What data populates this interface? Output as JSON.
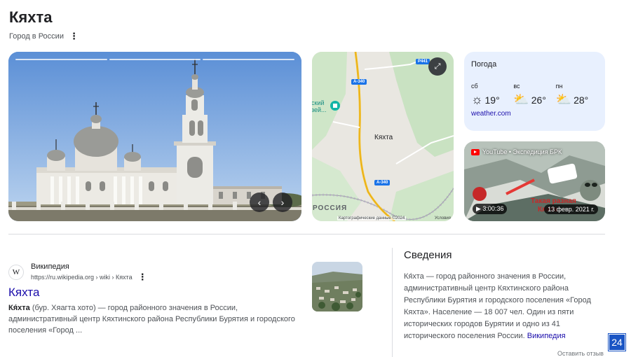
{
  "header": {
    "title": "Кяхта",
    "subtitle": "Город в России"
  },
  "photo": {
    "slide_count": 3,
    "prev_label": "‹",
    "next_label": "›"
  },
  "map": {
    "city": "Кяхта",
    "country": "РОССИЯ",
    "museum": "ский\nзей...",
    "roads": [
      "P441",
      "А-340",
      "А-340"
    ],
    "credit": "Картографические данные ©2024",
    "terms": "Условия"
  },
  "weather": {
    "title": "Погода",
    "days": [
      {
        "day": "сб",
        "temp": "19°",
        "icon": "sun-icon"
      },
      {
        "day": "вс",
        "temp": "26°",
        "icon": "partly-cloudy-icon"
      },
      {
        "day": "пн",
        "temp": "28°",
        "icon": "partly-cloudy-icon"
      }
    ],
    "source": "weather.com"
  },
  "video": {
    "channel": "YouTube • Экспедиция БРК",
    "duration": "3:00:36",
    "date": "13 февр. 2021 г.",
    "overlay_text": "Такая разная Кяхта"
  },
  "result": {
    "source_name": "Википедия",
    "favicon": "W",
    "url": "https://ru.wikipedia.org › wiki › Кяхта",
    "title": "Кяхта",
    "snippet_bold": "Кя́хта",
    "snippet": " (бур. Хяагта хото) — город районного значения в России, административный центр Кяхтинского района Республики Бурятия и городского поселения «Город ..."
  },
  "info": {
    "heading": "Сведения",
    "text": "Кя́хта — город районного значения в России, административный центр Кяхтинского района Республики Бурятия и городского поселения «Город Кяхта». Население — 18 007 чел. Один из пяти исторических городов Бурятии и одно из 41 исторического поселения России. ",
    "link": "Википедия",
    "feedback": "Оставить отзыв"
  },
  "badge": "24"
}
